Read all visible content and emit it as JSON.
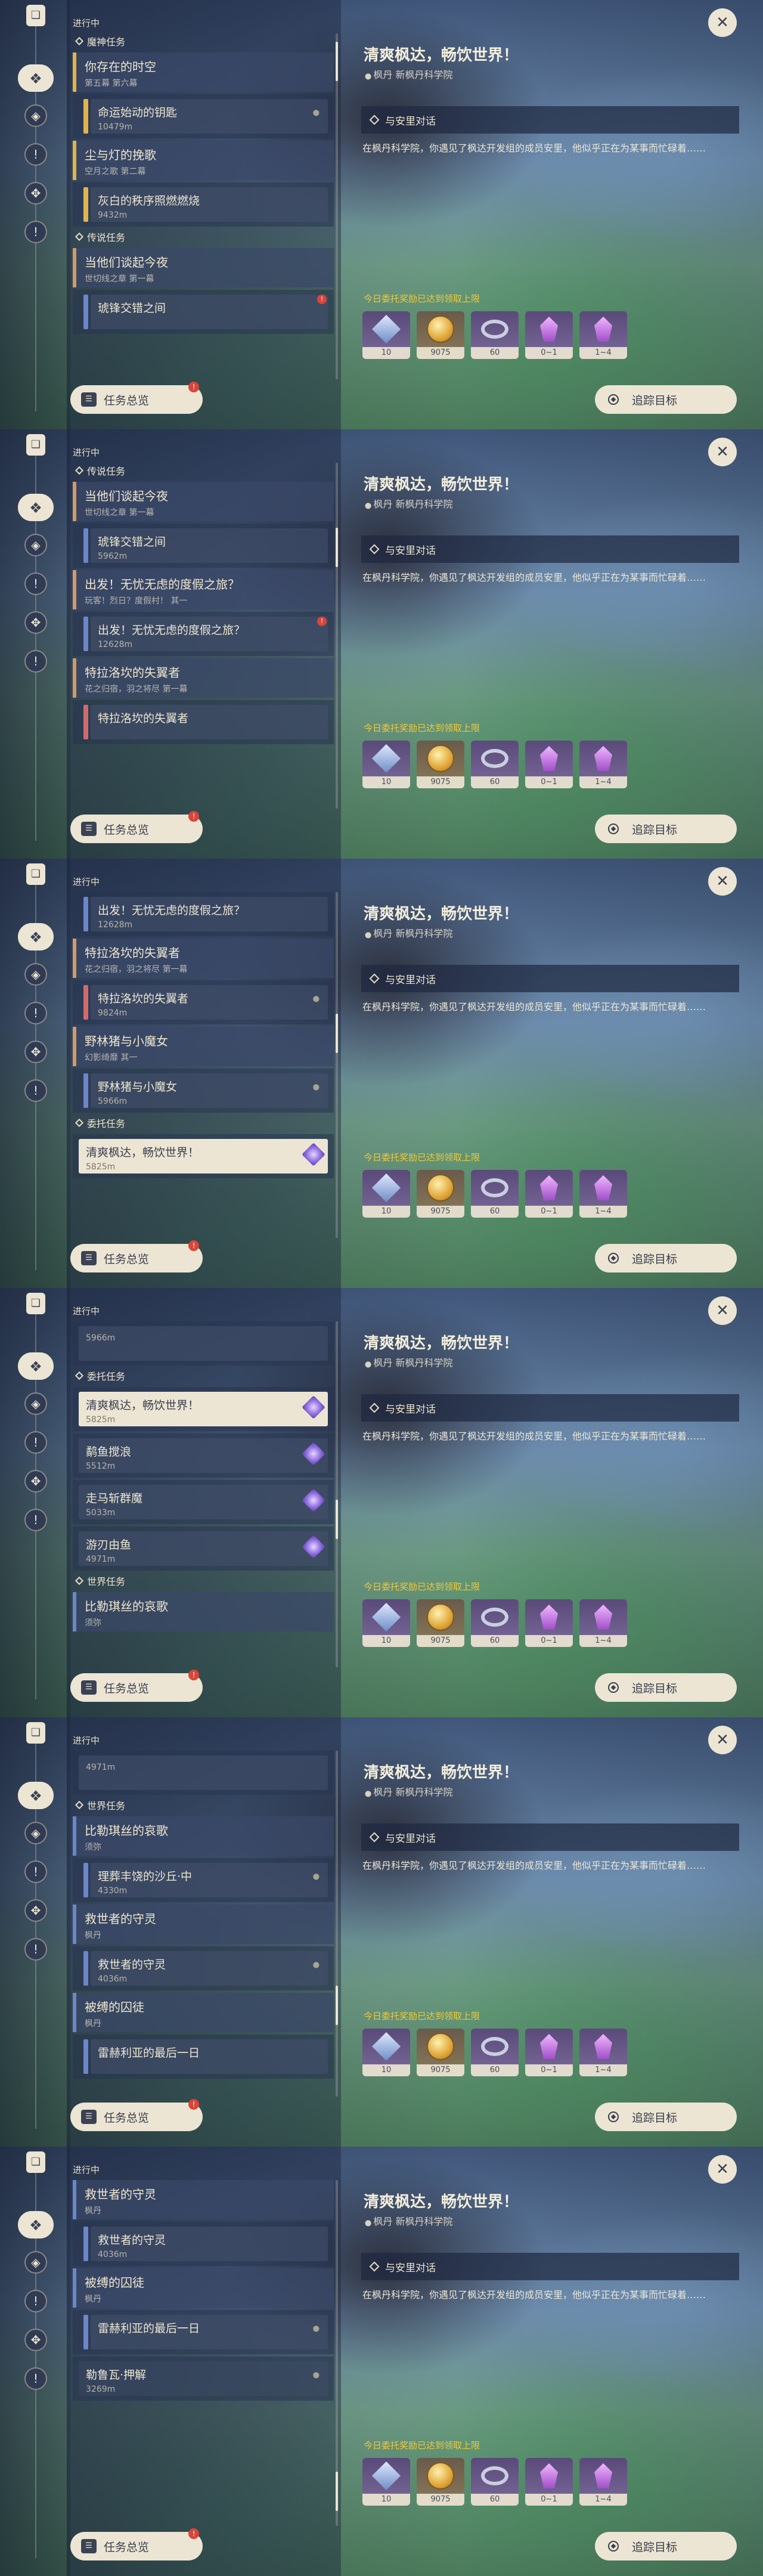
{
  "common": {
    "status_label": "进行中",
    "overview_button": "任务总览",
    "overview_badge": "!",
    "track_button": "追踪目标",
    "close_glyph": "✕",
    "rail_icons": [
      "quest-book-icon",
      "quest-category-icon",
      "archon-quest-icon",
      "story-quest-icon",
      "commission-icon",
      "world-quest-icon"
    ]
  },
  "detail": {
    "frames": [
      {
        "title": "清爽枫达，畅饮世界！",
        "location": "枫丹 新枫丹科学院",
        "objective": "与安里对话",
        "description": "在枫丹科学院，你遇见了枫达开发组的成员安里，他似乎正在为某事而忙碌着……",
        "reward_note": "今日委托奖励已达到领取上限"
      },
      {
        "title": "清爽枫达，畅饮世界！",
        "location": "枫丹 新枫丹科学院",
        "objective": "与安里对话",
        "description": "在枫丹科学院，你遇见了枫达开发组的成员安里，他似乎正在为某事而忙碌着……",
        "reward_note": "今日委托奖励已达到领取上限"
      },
      {
        "title": "清爽枫达，畅饮世界！",
        "location": "枫丹 新枫丹科学院",
        "objective": "与安里对话",
        "description": "在枫丹科学院，你遇见了枫达开发组的成员安里，他似乎正在为某事而忙碌着……",
        "reward_note": "今日委托奖励已达到领取上限"
      },
      {
        "title": "清爽枫达，畅饮世界！",
        "location": "枫丹 新枫丹科学院",
        "objective": "与安里对话",
        "description": "在枫丹科学院，你遇见了枫达开发组的成员安里，他似乎正在为某事而忙碌着……",
        "reward_note": "今日委托奖励已达到领取上限"
      },
      {
        "title": "清爽枫达，畅饮世界！",
        "location": "枫丹 新枫丹科学院",
        "objective": "与安里对话",
        "description": "在枫丹科学院，你遇见了枫达开发组的成员安里，他似乎正在为某事而忙碌着……",
        "reward_note": "今日委托奖励已达到领取上限"
      },
      {
        "title": "清爽枫达，畅饮世界！",
        "location": "枫丹 新枫丹科学院",
        "objective": "与安里对话",
        "description": "在枫丹科学院，你遇见了枫达开发组的成员安里，他似乎正在为某事而忙碌着……",
        "reward_note": "今日委托奖励已达到领取上限"
      }
    ]
  },
  "rewards": [
    {
      "name": "adventure-exp-icon",
      "qty": "10",
      "color": "#6e8ec6"
    },
    {
      "name": "mora-icon",
      "qty": "9075",
      "color": "#d9a63a"
    },
    {
      "name": "companionship-exp-icon",
      "qty": "60",
      "color": "#c9cfe0"
    },
    {
      "name": "mystic-ore-icon",
      "qty": "0~1",
      "color": "#a14fc9"
    },
    {
      "name": "crystal-chunk-icon",
      "qty": "1~4",
      "color": "#a14fc9"
    }
  ],
  "frames": [
    {
      "rows": [
        {
          "kind": "section",
          "text": "魔神任务"
        },
        {
          "kind": "header",
          "style": "archon",
          "title": "你存在的时空",
          "sub": "第五幕 第六幕"
        },
        {
          "kind": "item",
          "bar": "gold",
          "name": "命运始动的钥匙",
          "dist": "10479m",
          "pin": "pin"
        },
        {
          "kind": "header",
          "style": "archon",
          "title": "尘与灯的挽歌",
          "sub": "空月之歌 第二幕"
        },
        {
          "kind": "item",
          "bar": "gold",
          "name": "灰白的秩序照燃燃烧",
          "dist": "9432m",
          "pin": "none"
        },
        {
          "kind": "section",
          "text": "传说任务"
        },
        {
          "kind": "header",
          "style": "legend",
          "title": "当他们谈起今夜",
          "sub": "世切线之章 第一幕"
        },
        {
          "kind": "item",
          "bar": "blue",
          "name": "琥锋交错之间",
          "dist": "",
          "pin": "flag"
        }
      ]
    },
    {
      "rows": [
        {
          "kind": "section",
          "text": "传说任务"
        },
        {
          "kind": "header",
          "style": "legend",
          "title": "当他们谈起今夜",
          "sub": "世切线之章 第一幕"
        },
        {
          "kind": "item",
          "bar": "blue",
          "name": "琥锋交错之间",
          "dist": "5962m",
          "pin": "none"
        },
        {
          "kind": "header",
          "style": "legend",
          "title": "出发！无忧无虑的度假之旅？",
          "sub": "玩客！烈日？度假村！ 其一"
        },
        {
          "kind": "item",
          "bar": "blue",
          "name": "出发！无忧无虑的度假之旅？",
          "dist": "12628m",
          "pin": "flag"
        },
        {
          "kind": "header",
          "style": "legend",
          "title": "特拉洛坎的失翼者",
          "sub": "花之归宿，羽之将尽 第一幕"
        },
        {
          "kind": "item",
          "bar": "red",
          "name": "特拉洛坎的失翼者",
          "dist": "",
          "pin": "none"
        }
      ]
    },
    {
      "rows": [
        {
          "kind": "item",
          "bar": "blue",
          "name": "出发！无忧无虑的度假之旅？",
          "dist": "12628m",
          "pin": "none"
        },
        {
          "kind": "header",
          "style": "legend",
          "title": "特拉洛坎的失翼者",
          "sub": "花之归宿，羽之将尽 第一幕"
        },
        {
          "kind": "item",
          "bar": "red",
          "name": "特拉洛坎的失翼者",
          "dist": "9824m",
          "pin": "pin"
        },
        {
          "kind": "header",
          "style": "legend",
          "title": "野林猪与小魔女",
          "sub": "幻影绮靡 其一"
        },
        {
          "kind": "item",
          "bar": "blue",
          "name": "野林猪与小魔女",
          "dist": "5966m",
          "pin": "pin"
        },
        {
          "kind": "section",
          "text": "委托任务"
        },
        {
          "kind": "item",
          "bar": "none",
          "name": "清爽枫达，畅饮世界！",
          "dist": "5825m",
          "pin": "purple",
          "selected": true
        }
      ]
    },
    {
      "rows": [
        {
          "kind": "item",
          "bar": "none",
          "name": "",
          "dist": "5966m",
          "pin": "none"
        },
        {
          "kind": "section",
          "text": "委托任务"
        },
        {
          "kind": "item",
          "bar": "none",
          "name": "清爽枫达，畅饮世界！",
          "dist": "5825m",
          "pin": "purple",
          "selected": true
        },
        {
          "kind": "item",
          "bar": "none",
          "name": "鹬鱼搅浪",
          "dist": "5512m",
          "pin": "purple"
        },
        {
          "kind": "item",
          "bar": "none",
          "name": "走马斩群魔",
          "dist": "5033m",
          "pin": "purple"
        },
        {
          "kind": "item",
          "bar": "none",
          "name": "游刃由鱼",
          "dist": "4971m",
          "pin": "purple"
        },
        {
          "kind": "section",
          "text": "世界任务"
        },
        {
          "kind": "header",
          "style": "world",
          "title": "比勒琪丝的哀歌",
          "sub": "须弥"
        }
      ]
    },
    {
      "rows": [
        {
          "kind": "item",
          "bar": "none",
          "name": "",
          "dist": "4971m",
          "pin": "none"
        },
        {
          "kind": "section",
          "text": "世界任务"
        },
        {
          "kind": "header",
          "style": "world",
          "title": "比勒琪丝的哀歌",
          "sub": "须弥"
        },
        {
          "kind": "item",
          "bar": "blue",
          "name": "理葬丰饶的沙丘·中",
          "dist": "4330m",
          "pin": "pin"
        },
        {
          "kind": "header",
          "style": "world",
          "title": "救世者的守灵",
          "sub": "枫丹"
        },
        {
          "kind": "item",
          "bar": "blue",
          "name": "救世者的守灵",
          "dist": "4036m",
          "pin": "pin"
        },
        {
          "kind": "header",
          "style": "world",
          "title": "被缚的囚徒",
          "sub": "枫丹"
        },
        {
          "kind": "item",
          "bar": "blue",
          "name": "雷赫利亚的最后一日",
          "dist": "",
          "pin": "none"
        }
      ]
    },
    {
      "rows": [
        {
          "kind": "header",
          "style": "world",
          "title": "救世者的守灵",
          "sub": "枫丹"
        },
        {
          "kind": "item",
          "bar": "blue",
          "name": "救世者的守灵",
          "dist": "4036m",
          "pin": "none"
        },
        {
          "kind": "header",
          "style": "world",
          "title": "被缚的囚徒",
          "sub": "枫丹"
        },
        {
          "kind": "item",
          "bar": "blue",
          "name": "雷赫利亚的最后一日",
          "dist": "",
          "pin": "pin"
        },
        {
          "kind": "item",
          "bar": "none",
          "name": "勒鲁瓦·押解",
          "dist": "3269m",
          "pin": "pin",
          "plain": true
        }
      ]
    }
  ]
}
